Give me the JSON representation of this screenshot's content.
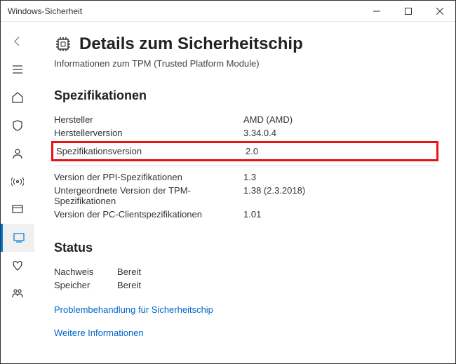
{
  "window": {
    "title": "Windows-Sicherheit"
  },
  "header": {
    "title": "Details zum Sicherheitschip",
    "subtitle": "Informationen zum TPM (Trusted Platform Module)"
  },
  "specs": {
    "heading": "Spezifikationen",
    "rows1": [
      {
        "k": "Hersteller",
        "v": "AMD (AMD)"
      },
      {
        "k": "Herstellerversion",
        "v": "3.34.0.4"
      }
    ],
    "highlighted": {
      "k": "Spezifikationsversion",
      "v": "2.0"
    },
    "rows2": [
      {
        "k": "Version der PPI-Spezifikationen",
        "v": "1.3"
      },
      {
        "k": "Untergeordnete Version der TPM-Spezifikationen",
        "v": "1.38 (2.3.2018)"
      },
      {
        "k": "Version der PC-Clientspezifikationen",
        "v": "1.01"
      }
    ]
  },
  "status": {
    "heading": "Status",
    "rows": [
      {
        "k": "Nachweis",
        "v": "Bereit"
      },
      {
        "k": "Speicher",
        "v": "Bereit"
      }
    ]
  },
  "links": {
    "troubleshoot": "Problembehandlung für Sicherheitschip",
    "more": "Weitere Informationen"
  }
}
